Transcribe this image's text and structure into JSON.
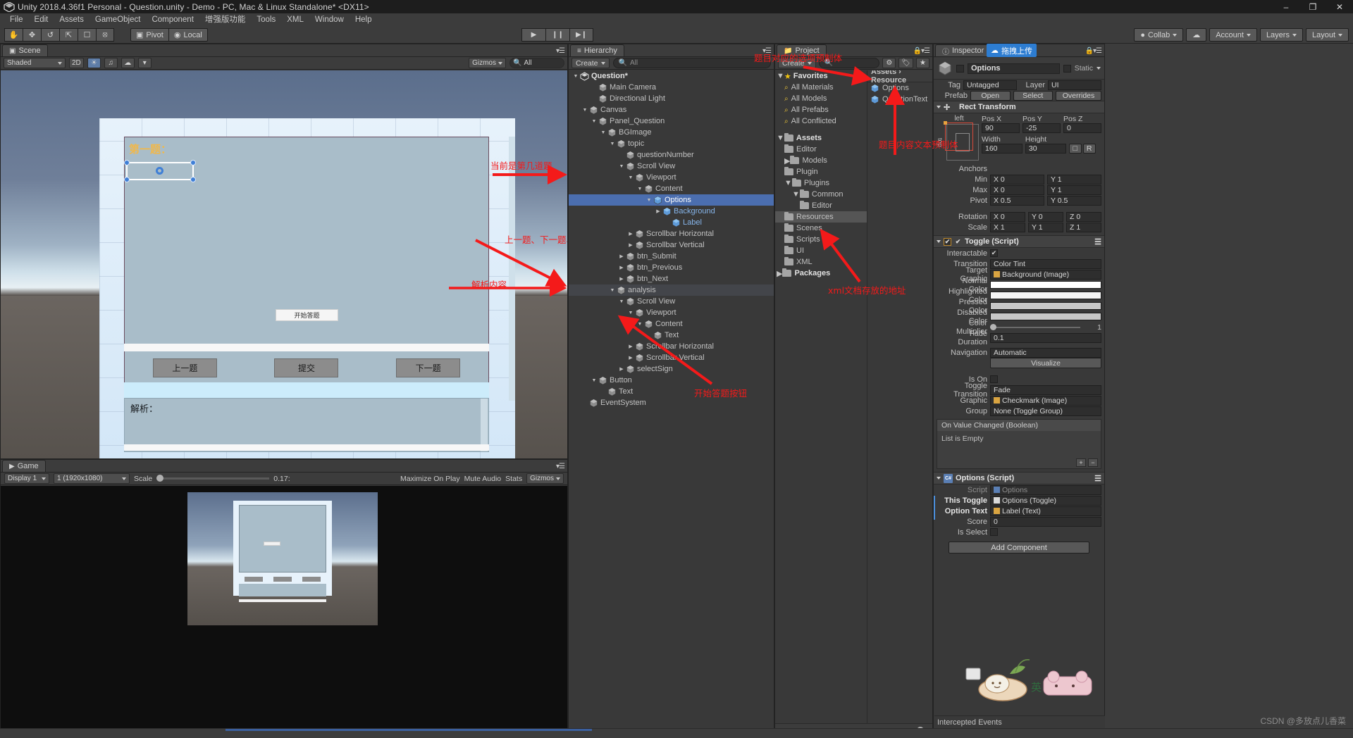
{
  "window": {
    "title": "Unity 2018.4.36f1 Personal - Question.unity - Demo - PC, Mac & Linux Standalone* <DX11>",
    "minimize": "–",
    "maximize": "❐",
    "close": "✕"
  },
  "menubar": [
    "File",
    "Edit",
    "Assets",
    "GameObject",
    "Component",
    "增强版功能",
    "Tools",
    "XML",
    "Window",
    "Help"
  ],
  "toolbar": {
    "tools": [
      "hand-tool",
      "move-tool",
      "rotate-tool",
      "scale-tool",
      "rect-tool",
      "transform-tool"
    ],
    "pivot": "Pivot",
    "local": "Local",
    "play": "▶",
    "pause": "❙❙",
    "step": "▶❙",
    "collab": "Collab",
    "cloud": "☁",
    "account": "Account",
    "layers": "Layers",
    "layout": "Layout",
    "upload_badge": "拖拽上传"
  },
  "scene": {
    "tab": "Scene",
    "shading": "Shaded",
    "mode2d": "2D",
    "gizmos_label": "Gizmos",
    "search_placeholder": "All",
    "content": {
      "question_title": "第一题：",
      "start_button": "开始答题",
      "prev_button": "上一题",
      "submit_button": "提交",
      "next_button": "下一题",
      "analysis_label": "解析："
    }
  },
  "game": {
    "tab": "Game",
    "display": "Display 1",
    "resolution": "1 (1920x1080)",
    "scale_label": "Scale",
    "scale_value": "0.17:",
    "maximize": "Maximize On Play",
    "mute": "Mute Audio",
    "stats": "Stats",
    "gizmos": "Gizmos"
  },
  "annotations": [
    {
      "text": "当前是第几道题"
    },
    {
      "text": "上一题、下一题、提交按钮"
    },
    {
      "text": "解析内容"
    },
    {
      "text": "题目对应的选项预制体"
    },
    {
      "text": "题目内容文本预制体"
    },
    {
      "text": "xml文档存放的地址"
    },
    {
      "text": "开始答题按钮"
    }
  ],
  "hierarchy": {
    "tab": "Hierarchy",
    "create": "Create",
    "search_placeholder": "All",
    "items": [
      {
        "label": "Question*",
        "depth": 0,
        "arrow": "down",
        "icon": "unity-scene-icon",
        "bold": true
      },
      {
        "label": "Main Camera",
        "depth": 2,
        "arrow": "none",
        "icon": "gameobject-icon"
      },
      {
        "label": "Directional Light",
        "depth": 2,
        "arrow": "none",
        "icon": "gameobject-icon"
      },
      {
        "label": "Canvas",
        "depth": 1,
        "arrow": "down",
        "icon": "gameobject-icon"
      },
      {
        "label": "Panel_Question",
        "depth": 2,
        "arrow": "down",
        "icon": "gameobject-icon"
      },
      {
        "label": "BGImage",
        "depth": 3,
        "arrow": "down",
        "icon": "gameobject-icon"
      },
      {
        "label": "topic",
        "depth": 4,
        "arrow": "down",
        "icon": "gameobject-icon"
      },
      {
        "label": "questionNumber",
        "depth": 5,
        "arrow": "none",
        "icon": "gameobject-icon"
      },
      {
        "label": "Scroll View",
        "depth": 5,
        "arrow": "down",
        "icon": "gameobject-icon"
      },
      {
        "label": "Viewport",
        "depth": 6,
        "arrow": "down",
        "icon": "gameobject-icon"
      },
      {
        "label": "Content",
        "depth": 7,
        "arrow": "down",
        "icon": "gameobject-icon"
      },
      {
        "label": "Options",
        "depth": 8,
        "arrow": "down",
        "icon": "prefab-icon",
        "selected": true
      },
      {
        "label": "Background",
        "depth": 9,
        "arrow": "right",
        "icon": "prefab-icon",
        "prefab": true
      },
      {
        "label": "Label",
        "depth": 10,
        "arrow": "none",
        "icon": "prefab-icon",
        "prefab": true
      },
      {
        "label": "Scrollbar Horizontal",
        "depth": 6,
        "arrow": "right",
        "icon": "gameobject-icon"
      },
      {
        "label": "Scrollbar Vertical",
        "depth": 6,
        "arrow": "right",
        "icon": "gameobject-icon"
      },
      {
        "label": "btn_Submit",
        "depth": 5,
        "arrow": "right",
        "icon": "gameobject-icon"
      },
      {
        "label": "btn_Previous",
        "depth": 5,
        "arrow": "right",
        "icon": "gameobject-icon"
      },
      {
        "label": "btn_Next",
        "depth": 5,
        "arrow": "right",
        "icon": "gameobject-icon"
      },
      {
        "label": "analysis",
        "depth": 4,
        "arrow": "down",
        "icon": "gameobject-icon",
        "hover": true
      },
      {
        "label": "Scroll View",
        "depth": 5,
        "arrow": "down",
        "icon": "gameobject-icon"
      },
      {
        "label": "Viewport",
        "depth": 6,
        "arrow": "down",
        "icon": "gameobject-icon"
      },
      {
        "label": "Content",
        "depth": 7,
        "arrow": "down",
        "icon": "gameobject-icon"
      },
      {
        "label": "Text",
        "depth": 8,
        "arrow": "none",
        "icon": "gameobject-icon"
      },
      {
        "label": "Scrollbar Horizontal",
        "depth": 6,
        "arrow": "right",
        "icon": "gameobject-icon"
      },
      {
        "label": "Scrollbar Vertical",
        "depth": 6,
        "arrow": "right",
        "icon": "gameobject-icon"
      },
      {
        "label": "selectSign",
        "depth": 5,
        "arrow": "right",
        "icon": "gameobject-icon"
      },
      {
        "label": "Button",
        "depth": 2,
        "arrow": "down",
        "icon": "gameobject-icon"
      },
      {
        "label": "Text",
        "depth": 3,
        "arrow": "none",
        "icon": "gameobject-icon"
      },
      {
        "label": "EventSystem",
        "depth": 1,
        "arrow": "none",
        "icon": "gameobject-icon"
      }
    ]
  },
  "project": {
    "tab": "Project",
    "create": "Create",
    "search_placeholder": "",
    "breadcrumb": "Assets › Resource",
    "tree": [
      {
        "label": "Favorites",
        "depth": 0,
        "arrow": "down",
        "icon": "star-icon",
        "bold": true
      },
      {
        "label": "All Materials",
        "depth": 1,
        "arrow": "none",
        "icon": "search-icon"
      },
      {
        "label": "All Models",
        "depth": 1,
        "arrow": "none",
        "icon": "search-icon"
      },
      {
        "label": "All Prefabs",
        "depth": 1,
        "arrow": "none",
        "icon": "search-icon"
      },
      {
        "label": "All Conflicted",
        "depth": 1,
        "arrow": "none",
        "icon": "search-icon"
      },
      {
        "label": "",
        "depth": 0,
        "arrow": "none",
        "icon": "spacer"
      },
      {
        "label": "Assets",
        "depth": 0,
        "arrow": "down",
        "icon": "folder-icon",
        "bold": true
      },
      {
        "label": "Editor",
        "depth": 1,
        "arrow": "none",
        "icon": "folder-icon"
      },
      {
        "label": "Models",
        "depth": 1,
        "arrow": "right",
        "icon": "folder-icon"
      },
      {
        "label": "Plugin",
        "depth": 1,
        "arrow": "none",
        "icon": "folder-icon"
      },
      {
        "label": "Plugins",
        "depth": 1,
        "arrow": "down",
        "icon": "folder-icon"
      },
      {
        "label": "Common",
        "depth": 2,
        "arrow": "down",
        "icon": "folder-icon"
      },
      {
        "label": "Editor",
        "depth": 3,
        "arrow": "none",
        "icon": "folder-icon"
      },
      {
        "label": "Resources",
        "depth": 1,
        "arrow": "none",
        "icon": "folder-icon",
        "selected": true
      },
      {
        "label": "Scenes",
        "depth": 1,
        "arrow": "none",
        "icon": "folder-icon"
      },
      {
        "label": "Scripts",
        "depth": 1,
        "arrow": "none",
        "icon": "folder-icon"
      },
      {
        "label": "UI",
        "depth": 1,
        "arrow": "none",
        "icon": "folder-icon"
      },
      {
        "label": "XML",
        "depth": 1,
        "arrow": "none",
        "icon": "folder-icon"
      },
      {
        "label": "Packages",
        "depth": 0,
        "arrow": "right",
        "icon": "folder-icon",
        "bold": true
      }
    ],
    "assets": [
      {
        "label": "Options",
        "icon": "prefab-icon"
      },
      {
        "label": "QuestionText",
        "icon": "prefab-icon"
      }
    ]
  },
  "inspector": {
    "tab": "Inspector",
    "object_name": "Options",
    "static_label": "Static",
    "tag_label": "Tag",
    "tag_value": "Untagged",
    "layer_label": "Layer",
    "layer_value": "UI",
    "prefab_label": "Prefab",
    "prefab_open": "Open",
    "prefab_select": "Select",
    "prefab_overrides": "Overrides",
    "rect_transform": {
      "title": "Rect Transform",
      "anchor_preset": "left",
      "anchor_preset_v": "top",
      "col_headers": [
        "Pos X",
        "Pos Y",
        "Pos Z"
      ],
      "pos": [
        "90",
        "-25",
        "0"
      ],
      "size_headers": [
        "Width",
        "Height"
      ],
      "size": [
        "160",
        "30"
      ],
      "anchors_label": "Anchors",
      "min_label": "Min",
      "min": [
        "X 0",
        "Y 1"
      ],
      "max_label": "Max",
      "max": [
        "X 0",
        "Y 1"
      ],
      "pivot_label": "Pivot",
      "pivot": [
        "X 0.5",
        "Y 0.5"
      ],
      "rotation_label": "Rotation",
      "rotation": [
        "X 0",
        "Y 0",
        "Z 0"
      ],
      "scale_label": "Scale",
      "scale": [
        "X 1",
        "Y 1",
        "Z 1"
      ],
      "blueprint": "R"
    },
    "toggle": {
      "title": "Toggle (Script)",
      "interactable_label": "Interactable",
      "interactable_value": true,
      "transition_label": "Transition",
      "transition_value": "Color Tint",
      "target_graphic_label": "Target Graphic",
      "target_graphic_value": "Background (Image)",
      "normal_color_label": "Normal Color",
      "normal_color": "#FFFFFF",
      "highlighted_color_label": "Highlighted Color",
      "highlighted_color": "#F5F5F5",
      "pressed_color_label": "Pressed Color",
      "pressed_color": "#C8C8C8",
      "disabled_color_label": "Disabled Color",
      "disabled_color": "#C8C8C8",
      "color_multiplier_label": "Color Multiplier",
      "color_multiplier": "1",
      "fade_duration_label": "Fade Duration",
      "fade_duration": "0.1",
      "navigation_label": "Navigation",
      "navigation_value": "Automatic",
      "visualize": "Visualize",
      "is_on_label": "Is On",
      "is_on_value": false,
      "toggle_transition_label": "Toggle Transition",
      "toggle_transition_value": "Fade",
      "graphic_label": "Graphic",
      "graphic_value": "Checkmark (Image)",
      "group_label": "Group",
      "group_value": "None (Toggle Group)",
      "event_header": "On Value Changed (Boolean)",
      "event_empty": "List is Empty",
      "plus": "+",
      "minus": "−"
    },
    "options_script": {
      "title": "Options (Script)",
      "script_label": "Script",
      "script_value": "Options",
      "this_toggle_label": "This Toggle",
      "this_toggle_value": "Options (Toggle)",
      "option_text_label": "Option Text",
      "option_text_value": "Label (Text)",
      "score_label": "Score",
      "score_value": "0",
      "is_select_label": "Is Select",
      "is_select_value": false
    },
    "add_component": "Add Component"
  },
  "footer": {
    "intercepted_events": "Intercepted Events",
    "watermark": "CSDN @多放点儿香菜",
    "mascot_text": "英"
  },
  "colors": {
    "accent_blue": "#4b6eaf",
    "annotation_red": "#f41a1a",
    "panel_bg": "#393939",
    "toolbar_bg": "#3c3c3c",
    "title_orange": "#f0b84b"
  }
}
